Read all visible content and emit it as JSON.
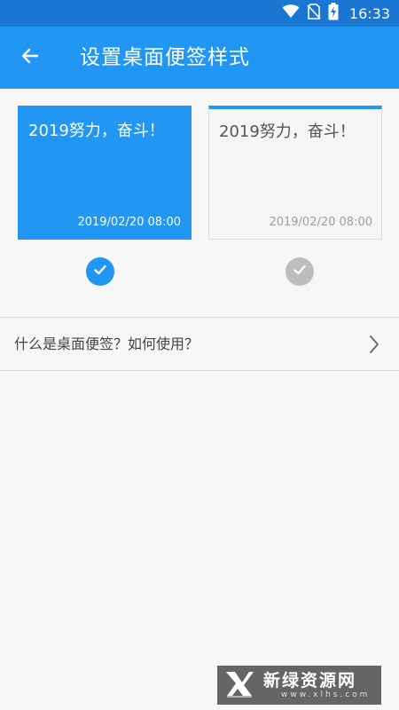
{
  "status_bar": {
    "time": "16:33"
  },
  "app_bar": {
    "title": "设置桌面便签样式"
  },
  "styles": [
    {
      "text": "2019努力，奋斗！",
      "date": "2019/02/20 08:00",
      "selected": true
    },
    {
      "text": "2019努力，奋斗！",
      "date": "2019/02/20 08:00",
      "selected": false
    }
  ],
  "help": {
    "label": "什么是桌面便签？如何使用？"
  },
  "watermark": {
    "title": "新绿资源网",
    "subtitle": "www.xlhs.com"
  },
  "colors": {
    "status_bar": "#1976d2",
    "app_bar": "#2196f3",
    "accent": "#2196f3",
    "unselected": "#bdbdbd",
    "background": "#f7f7f7"
  },
  "icons": {
    "back": "arrow-left-icon",
    "check": "checkmark-icon",
    "chevron": "chevron-right-icon",
    "wifi": "wifi-icon",
    "no_sim": "no-sim-icon",
    "battery": "battery-charging-icon"
  }
}
